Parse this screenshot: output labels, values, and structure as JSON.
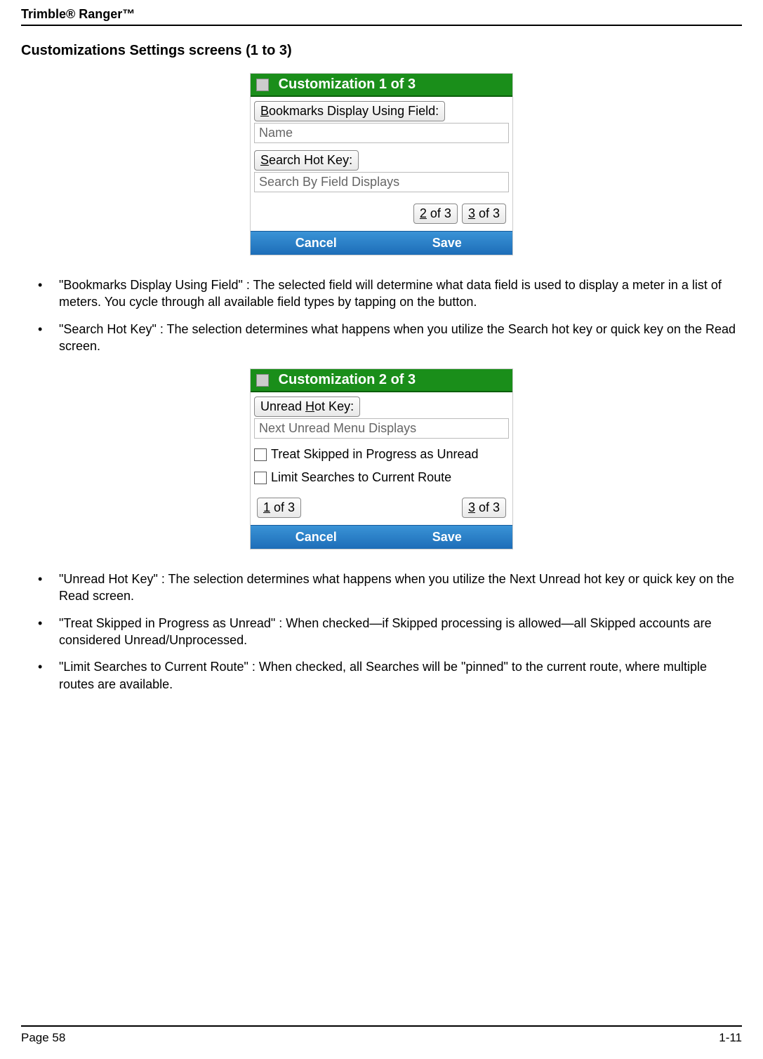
{
  "header": "Trimble® Ranger™",
  "section_title": "Customizations Settings screens (1 to 3)",
  "screen1": {
    "title": "Customization 1 of 3",
    "bookmarks_label_pre": "B",
    "bookmarks_label_rest": "ookmarks Display Using Field:",
    "bookmarks_value": "Name",
    "search_label_pre": "S",
    "search_label_rest": "earch Hot Key:",
    "search_value": "Search By Field Displays",
    "nav2_pre": "2",
    "nav2_rest": " of 3",
    "nav3_pre": "3",
    "nav3_rest": " of 3",
    "cancel": "Cancel",
    "save": "Save"
  },
  "bullet1": "\"Bookmarks Display Using Field\" : The selected field will determine what data field is used to display a meter in a list of meters.  You cycle through all available field types by tapping on the button.",
  "bullet2": "\"Search Hot Key\" : The selection determines what happens when you utilize the Search hot key or quick key on the Read screen.",
  "screen2": {
    "title": "Customization 2 of 3",
    "unread_label_pre_space": "Unread ",
    "unread_label_u": "H",
    "unread_label_rest": "ot Key:",
    "unread_value": "Next Unread Menu Displays",
    "treat_pre": "T",
    "treat_rest": "reat Skipped in Progress as Unread",
    "limit_pre_space": "Limit ",
    "limit_u": "S",
    "limit_rest": "earches to Current Route",
    "nav1_pre": "1",
    "nav1_rest": " of 3",
    "nav3_pre": "3",
    "nav3_rest": " of 3",
    "cancel": "Cancel",
    "save": "Save"
  },
  "bullet3": "\"Unread Hot Key\" : The selection determines what happens when you utilize the Next Unread hot key or quick key on the Read screen.",
  "bullet4": "\"Treat Skipped in Progress as Unread\" : When checked—if Skipped processing is allowed—all Skipped accounts are considered Unread/Unprocessed.",
  "bullet5": "\"Limit Searches to Current Route\" : When checked, all Searches will be \"pinned\" to the current route, where multiple routes are available.",
  "page_left": "Page 58",
  "page_right": "1-11"
}
